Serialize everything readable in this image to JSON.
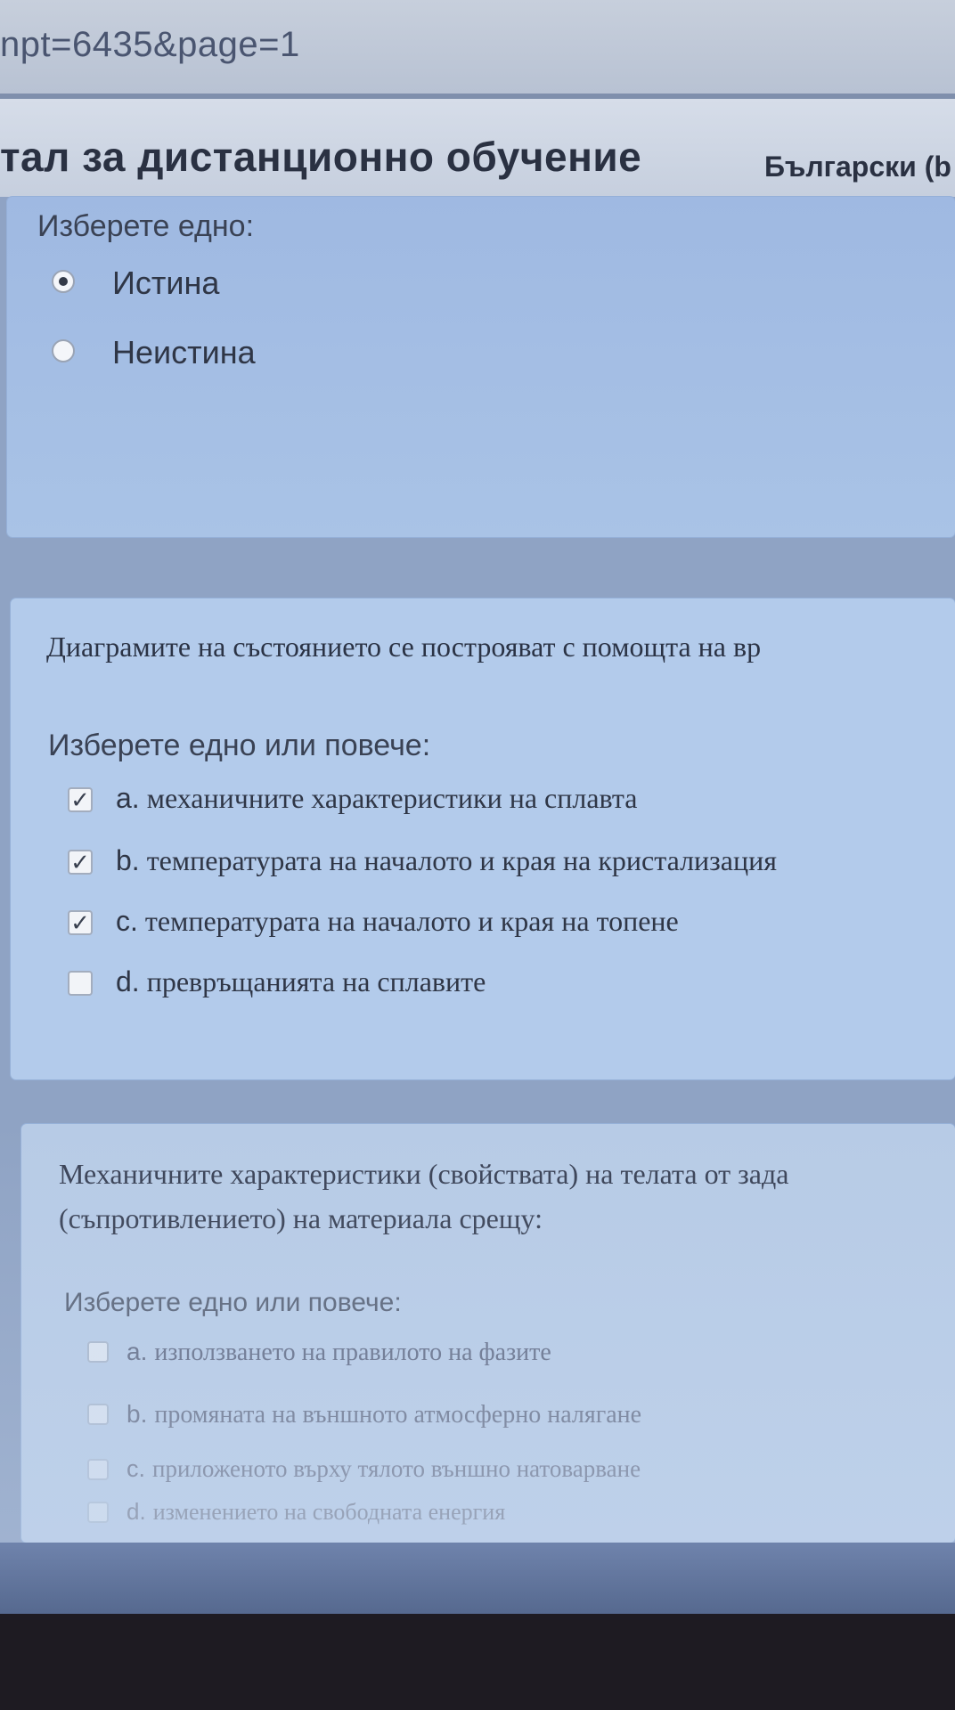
{
  "browser": {
    "url_fragment": "npt=6435&page=1"
  },
  "header": {
    "site_title": "тал за дистанционно обучение",
    "language": "Български (b"
  },
  "questions": [
    {
      "prompt": "Изберете едно:",
      "options": [
        {
          "label": "Истина",
          "checked": true
        },
        {
          "label": "Неистина",
          "checked": false
        }
      ]
    },
    {
      "text": "Диаграмите на състоянието се построяват с помощта на вр",
      "prompt": "Изберете едно или повече:",
      "options": [
        {
          "letter": "a.",
          "label": "механичните характеристики на сплавта",
          "checked": true
        },
        {
          "letter": "b.",
          "label": "температурата на началото и края на кристализация",
          "checked": true
        },
        {
          "letter": "c.",
          "label": "температурата на началото и края на топене",
          "checked": true
        },
        {
          "letter": "d.",
          "label": "превръщанията на сплавите",
          "checked": false
        }
      ]
    },
    {
      "text_line1": "Механичните характеристики (свойствата) на телата от зада",
      "text_line2": "(съпротивлението) на материала срещу:",
      "prompt": "Изберете едно или повече:",
      "options": [
        {
          "letter": "a.",
          "label": "използването на правилото на фазите",
          "checked": false
        },
        {
          "letter": "b.",
          "label": "промяната на външното атмосферно налягане",
          "checked": false
        },
        {
          "letter": "c.",
          "label": "приложеното върху тялото външно натоварване",
          "checked": false
        },
        {
          "letter": "d.",
          "label": "изменението на свободната енергия",
          "checked": false
        }
      ]
    }
  ],
  "colors": {
    "card_bg": "#a6c0e4",
    "text": "#2b3345"
  }
}
